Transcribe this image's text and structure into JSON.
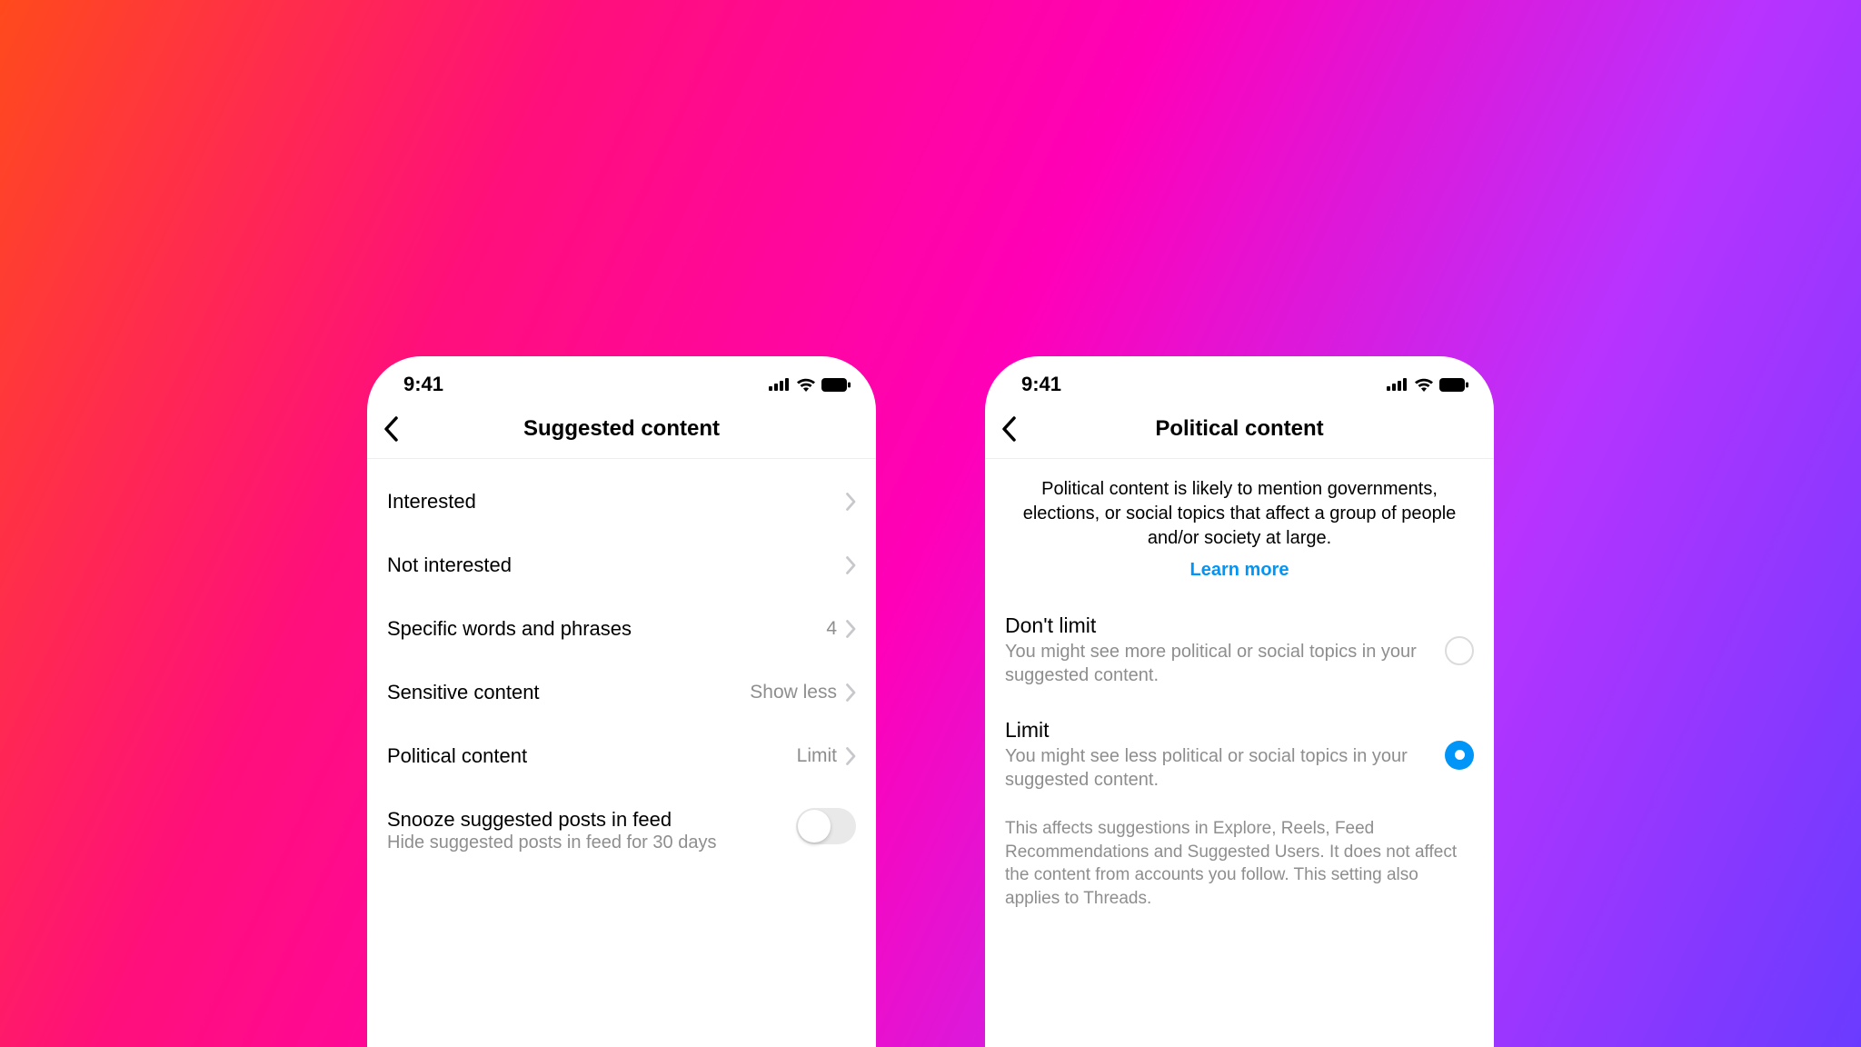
{
  "status": {
    "time": "9:41"
  },
  "left": {
    "title": "Suggested content",
    "rows": [
      {
        "label": "Interested",
        "value": ""
      },
      {
        "label": "Not interested",
        "value": ""
      },
      {
        "label": "Specific words and phrases",
        "value": "4"
      },
      {
        "label": "Sensitive content",
        "value": "Show less"
      },
      {
        "label": "Political content",
        "value": "Limit"
      }
    ],
    "snooze": {
      "label": "Snooze suggested posts in feed",
      "sublabel": "Hide suggested posts in feed for 30 days"
    }
  },
  "right": {
    "title": "Political content",
    "info": "Political content is likely to mention governments, elections, or social topics that affect a group of people and/or society at large.",
    "learn_more": "Learn more",
    "options": [
      {
        "title": "Don't limit",
        "desc": "You might see more political or social topics in your suggested content.",
        "selected": false
      },
      {
        "title": "Limit",
        "desc": "You might see less political or social topics in your suggested content.",
        "selected": true
      }
    ],
    "footer": "This affects suggestions in Explore, Reels, Feed Recommendations and Suggested Users. It does not affect the content from accounts you follow. This setting also applies to Threads."
  }
}
